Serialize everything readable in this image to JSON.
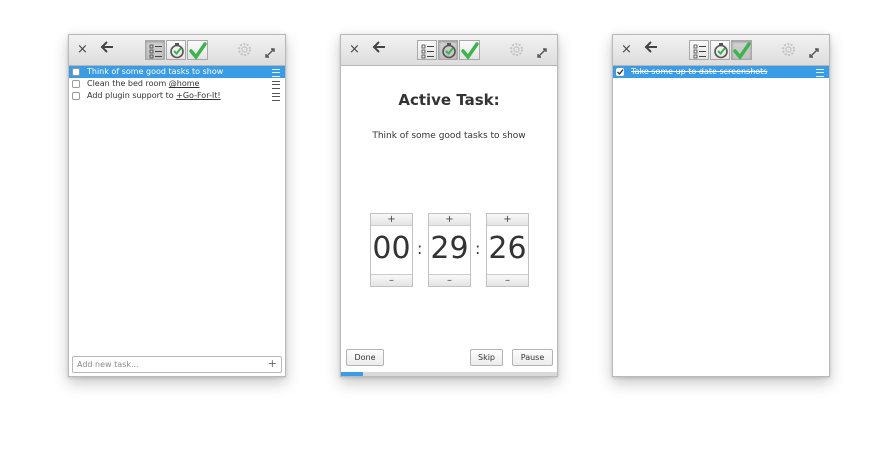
{
  "window1": {
    "tasks": [
      {
        "text": "Think of some good tasks to show",
        "tag": "",
        "selected": true
      },
      {
        "text": "Clean the bed room ",
        "tag": "@home",
        "selected": false
      },
      {
        "text": "Add plugin support to ",
        "tag": "+Go-For-It!",
        "selected": false
      }
    ],
    "new_task_placeholder": "Add new task...",
    "add_symbol": "+"
  },
  "window2": {
    "heading": "Active Task:",
    "task_name": "Think of some good tasks to show",
    "timer": {
      "hours": "00",
      "minutes": "29",
      "seconds": "26",
      "separator": ":"
    },
    "spin_up": "+",
    "spin_down": "–",
    "done_label": "Done",
    "skip_label": "Skip",
    "pause_label": "Pause",
    "progress_fraction": 0.1
  },
  "window3": {
    "tasks": [
      {
        "text": "Take some up to date screenshots",
        "done": true,
        "selected": true
      }
    ]
  },
  "headerbar": {
    "close_symbol": "×",
    "back_symbol": "🡐",
    "icons": [
      "close-icon",
      "back-arrow-icon",
      "todo-list-icon",
      "timer-icon",
      "done-check-icon",
      "gear-icon",
      "expand-icon"
    ]
  },
  "colors": {
    "accent": "#3a9be6",
    "check_green": "#3bb54a"
  }
}
